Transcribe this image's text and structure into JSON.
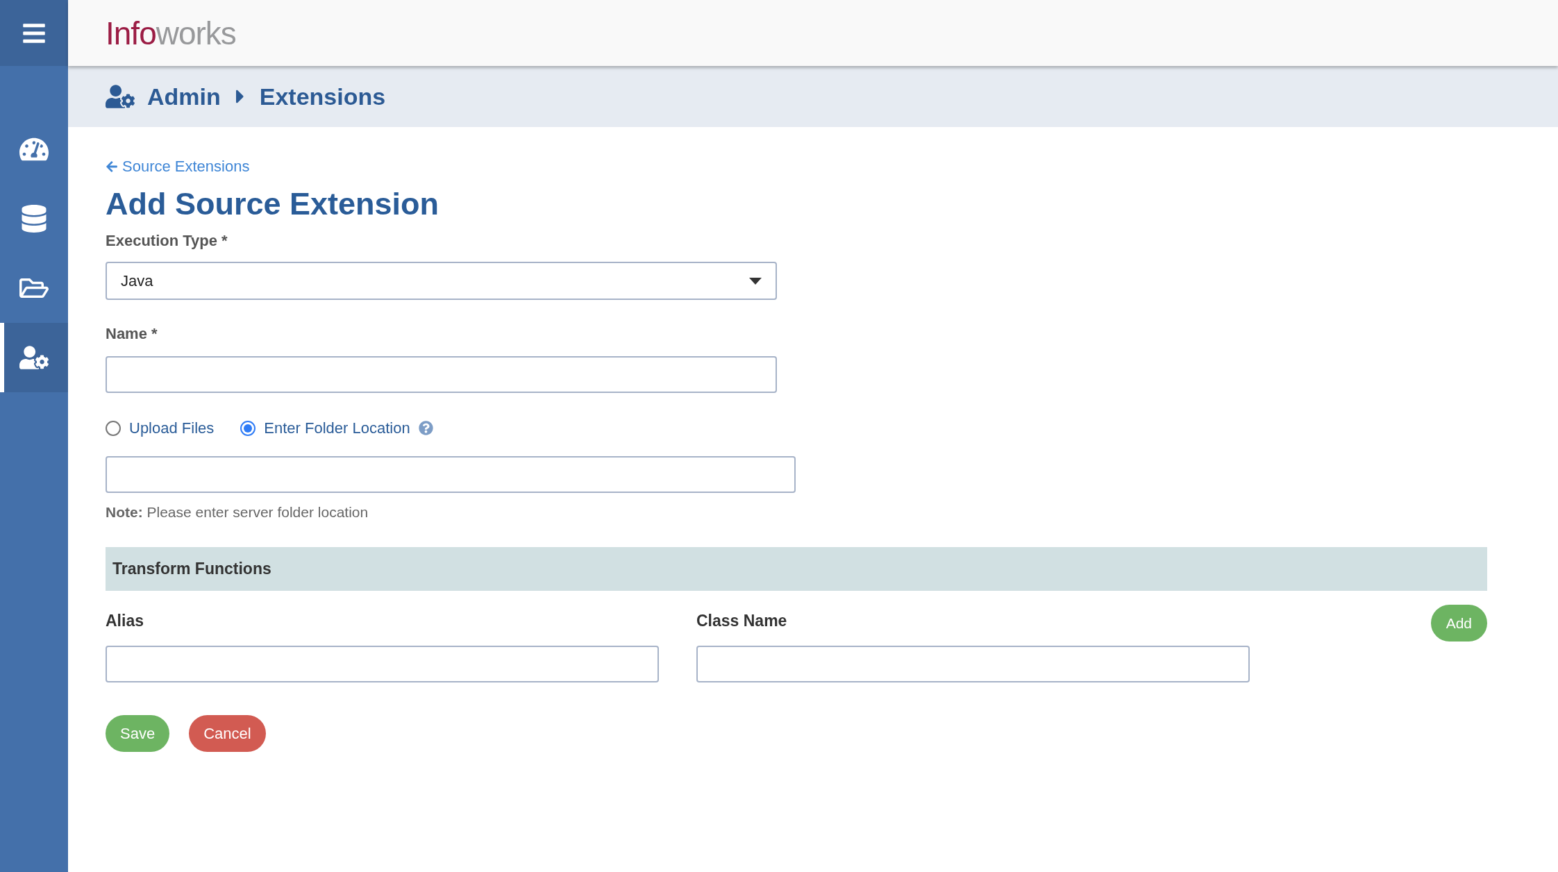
{
  "logo": {
    "primary": "Info",
    "secondary": "works"
  },
  "sidebar": {
    "items": [
      {
        "kind": "dashboard",
        "selected": false
      },
      {
        "kind": "database",
        "selected": false
      },
      {
        "kind": "folder",
        "selected": false
      },
      {
        "kind": "admin",
        "selected": true
      }
    ]
  },
  "breadcrumb": [
    "Admin",
    "Extensions"
  ],
  "back_link": "Source Extensions",
  "title": "Add Source Extension",
  "execution_type": {
    "label": "Execution Type *",
    "value": "Java"
  },
  "name": {
    "label": "Name *"
  },
  "source_options": [
    {
      "label": "Upload Files",
      "selected": false,
      "help": false
    },
    {
      "label": "Enter Folder Location",
      "selected": true,
      "help": true
    }
  ],
  "note": {
    "lead": "Note:",
    "text": "Please enter server folder location"
  },
  "transform_functions": {
    "title": "Transform Functions",
    "columns": [
      "Alias",
      "Class Name"
    ],
    "add_button": "Add"
  },
  "buttons": [
    {
      "kind": "save",
      "label": "Save"
    },
    {
      "kind": "cancel",
      "label": "Cancel"
    }
  ]
}
